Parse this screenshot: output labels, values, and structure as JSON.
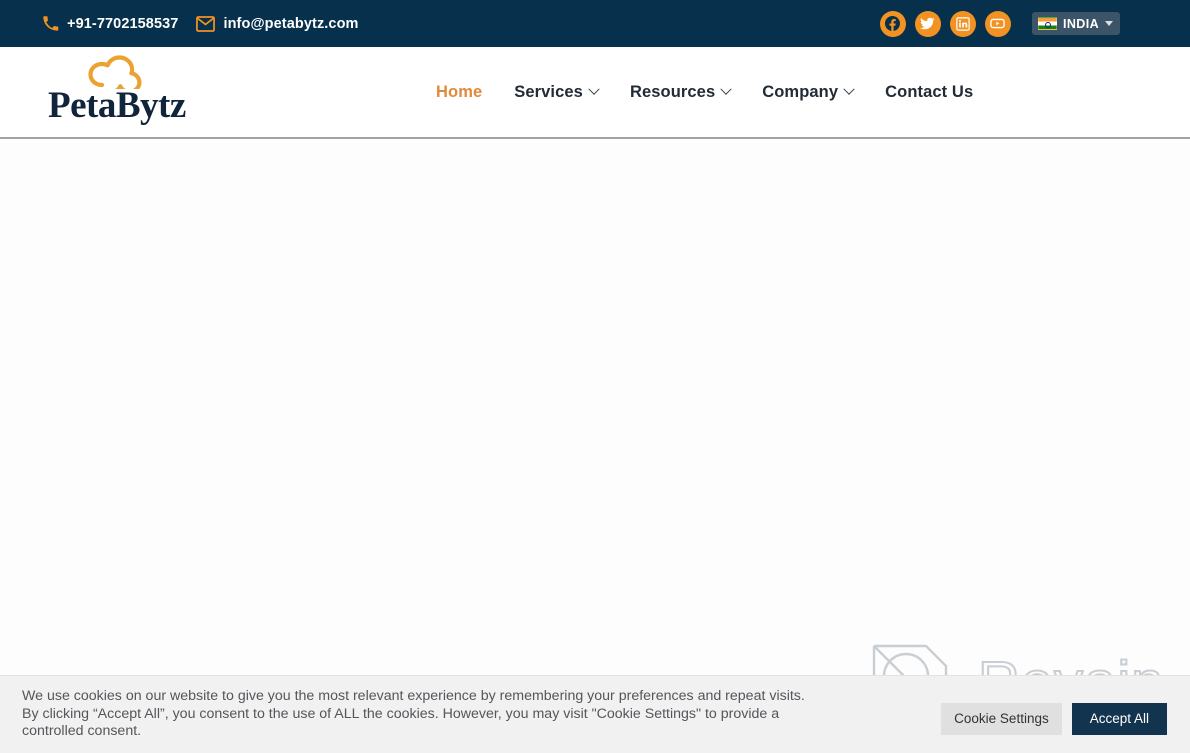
{
  "topbar": {
    "phone": {
      "icon": "phone-icon",
      "text": "+91-7702158537"
    },
    "email": {
      "icon": "envelope-icon",
      "text": "info@petabytz.com"
    },
    "social": [
      {
        "name": "facebook-icon",
        "label": "Facebook"
      },
      {
        "name": "twitter-icon",
        "label": "Twitter"
      },
      {
        "name": "linkedin-icon",
        "label": "LinkedIn"
      },
      {
        "name": "youtube-icon",
        "label": "YouTube"
      }
    ],
    "country_selector": {
      "label": "INDIA",
      "flag": "india-flag-icon",
      "caret": "chevron-down-icon"
    },
    "background_color": "#06304b",
    "accent_color": "#f29222"
  },
  "header": {
    "logo": {
      "text": "PetaBytz",
      "mark": "cloud-infinity-icon",
      "text_color": "#10243c",
      "mark_color": "#eca232"
    },
    "nav": [
      {
        "label": "Home",
        "active": true,
        "has_dropdown": false
      },
      {
        "label": "Services",
        "active": false,
        "has_dropdown": true
      },
      {
        "label": "Resources",
        "active": false,
        "has_dropdown": true
      },
      {
        "label": "Company",
        "active": false,
        "has_dropdown": true
      },
      {
        "label": "Contact Us",
        "active": false,
        "has_dropdown": false
      }
    ],
    "active_color": "#e08a3c"
  },
  "main": {
    "content": ""
  },
  "watermark": {
    "text": "Revain",
    "logo": "revain-q-logo-icon"
  },
  "cookie_banner": {
    "text": "We use cookies on our website to give you the most relevant experience by remembering your preferences and repeat visits. By clicking “Accept All”, you consent to the use of ALL the cookies. However, you may visit \"Cookie Settings\" to provide a controlled consent.",
    "settings_label": "Cookie Settings",
    "accept_label": "Accept All",
    "accept_color": "#12344f",
    "settings_color": "#e0e0e0"
  }
}
